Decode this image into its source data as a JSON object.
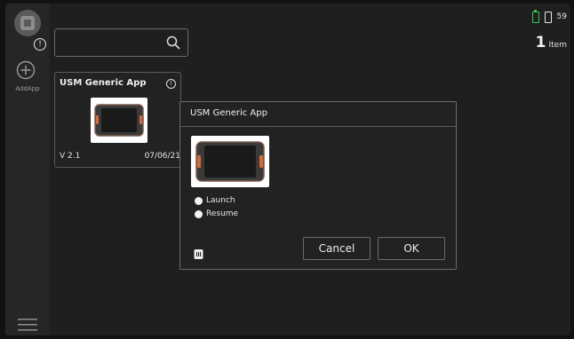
{
  "rail": {
    "add_app_label": "AddApp",
    "info_symbol": "!"
  },
  "status": {
    "text": "59"
  },
  "items": {
    "count": "1",
    "label": "Item"
  },
  "search": {
    "value": "",
    "placeholder": ""
  },
  "tile": {
    "title": "USM Generic App",
    "info_symbol": "!",
    "version": "V 2.1",
    "date": "07/06/21"
  },
  "dialog": {
    "title": "USM Generic App",
    "options": [
      "Launch",
      "Resume"
    ],
    "cancel_label": "Cancel",
    "ok_label": "OK"
  },
  "colors": {
    "background": "#1f1f1f",
    "rail": "#262626",
    "battery_green": "#3cc84a",
    "border": "#6a6a6a"
  },
  "icons": [
    "logo-icon",
    "info-icon",
    "add-icon",
    "menu-icon",
    "search-icon",
    "battery-icon",
    "device-thumbnail",
    "trash-icon"
  ]
}
